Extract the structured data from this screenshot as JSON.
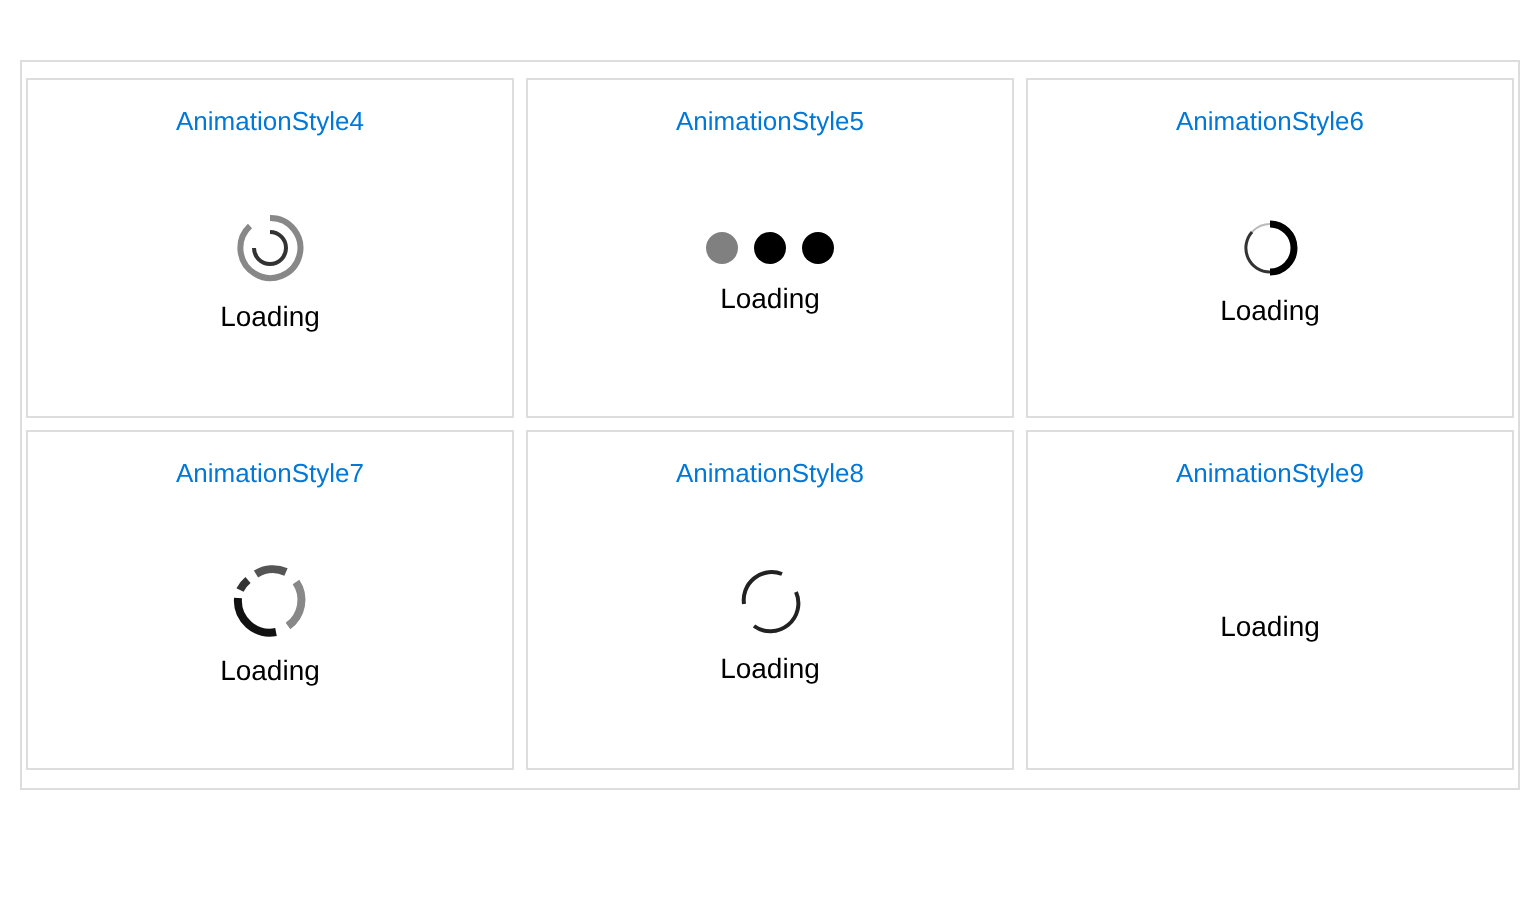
{
  "cards": [
    {
      "title": "AnimationStyle4",
      "kind": "rings",
      "label": "Loading"
    },
    {
      "title": "AnimationStyle5",
      "kind": "dots",
      "label": "Loading"
    },
    {
      "title": "AnimationStyle6",
      "kind": "crescent",
      "label": "Loading"
    },
    {
      "title": "AnimationStyle7",
      "kind": "segments",
      "label": "Loading"
    },
    {
      "title": "AnimationStyle8",
      "kind": "arcs",
      "label": "Loading"
    },
    {
      "title": "AnimationStyle9",
      "kind": "none",
      "label": "Loading"
    }
  ]
}
